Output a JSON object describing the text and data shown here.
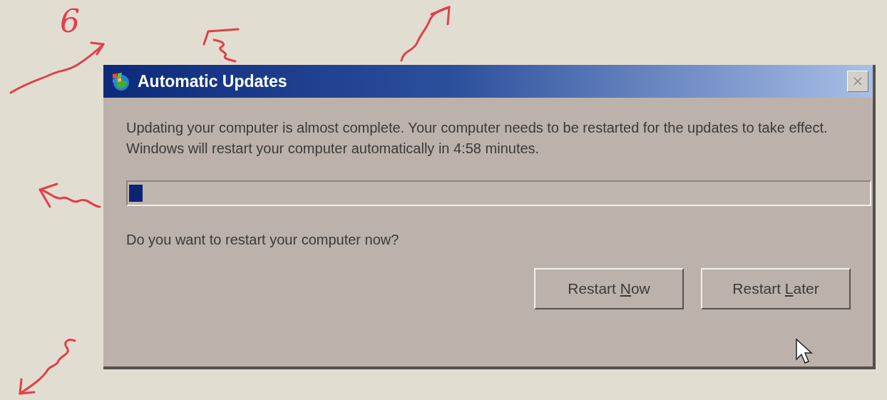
{
  "annotation": {
    "note": "6"
  },
  "window": {
    "title": "Automatic Updates"
  },
  "message": "Updating your computer is almost complete. Your computer needs to be restarted for the updates to take effect. Windows will restart your computer automatically in 4:58 minutes.",
  "progress": {
    "level": 0.018
  },
  "question": "Do you want to restart your computer now?",
  "buttons": [
    {
      "before": "Restart ",
      "key": "N",
      "after": "ow"
    },
    {
      "before": "Restart ",
      "key": "L",
      "after": "ater"
    }
  ]
}
